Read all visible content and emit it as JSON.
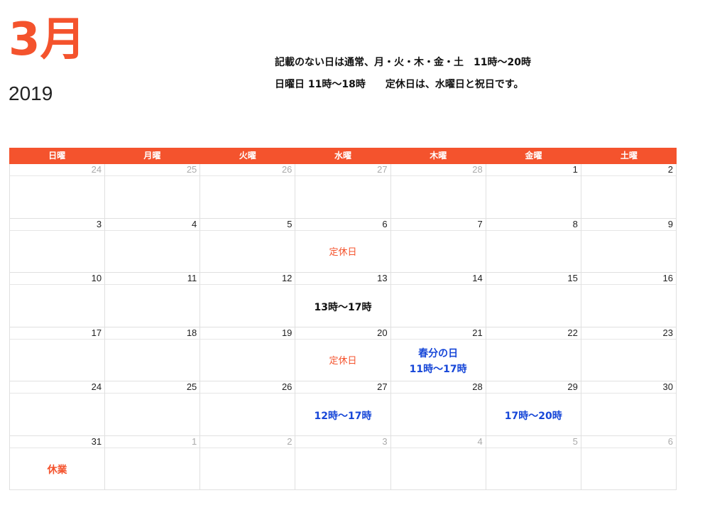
{
  "header": {
    "month": "3月",
    "year": "2019"
  },
  "notes": [
    "記載のない日は通常、月・火・木・金・土　11時〜20時",
    "日曜日 11時〜18時　　定休日は、水曜日と祝日です。"
  ],
  "weekdays": [
    "日曜",
    "月曜",
    "火曜",
    "水曜",
    "木曜",
    "金曜",
    "土曜"
  ],
  "colors": {
    "accent": "#f4532d",
    "blue": "#1747d8"
  },
  "weeks": [
    [
      {
        "day": "24",
        "other": true
      },
      {
        "day": "25",
        "other": true
      },
      {
        "day": "26",
        "other": true
      },
      {
        "day": "27",
        "other": true
      },
      {
        "day": "28",
        "other": true
      },
      {
        "day": "1"
      },
      {
        "day": "2"
      }
    ],
    [
      {
        "day": "3"
      },
      {
        "day": "4"
      },
      {
        "day": "5"
      },
      {
        "day": "6",
        "note": [
          "定休日"
        ],
        "style": "red"
      },
      {
        "day": "7"
      },
      {
        "day": "8"
      },
      {
        "day": "9"
      }
    ],
    [
      {
        "day": "10"
      },
      {
        "day": "11"
      },
      {
        "day": "12"
      },
      {
        "day": "13",
        "note": [
          "13時〜17時"
        ],
        "style": "dark"
      },
      {
        "day": "14"
      },
      {
        "day": "15"
      },
      {
        "day": "16"
      }
    ],
    [
      {
        "day": "17"
      },
      {
        "day": "18"
      },
      {
        "day": "19"
      },
      {
        "day": "20",
        "note": [
          "定休日"
        ],
        "style": "red"
      },
      {
        "day": "21",
        "note": [
          "春分の日",
          "11時〜17時"
        ],
        "style": "blue"
      },
      {
        "day": "22"
      },
      {
        "day": "23"
      }
    ],
    [
      {
        "day": "24"
      },
      {
        "day": "25"
      },
      {
        "day": "26"
      },
      {
        "day": "27",
        "note": [
          "12時〜17時"
        ],
        "style": "blue"
      },
      {
        "day": "28"
      },
      {
        "day": "29",
        "note": [
          "17時〜20時"
        ],
        "style": "blue"
      },
      {
        "day": "30"
      }
    ],
    [
      {
        "day": "31",
        "note": [
          "休業"
        ],
        "style": "redbold"
      },
      {
        "day": "1",
        "other": true
      },
      {
        "day": "2",
        "other": true
      },
      {
        "day": "3",
        "other": true
      },
      {
        "day": "4",
        "other": true
      },
      {
        "day": "5",
        "other": true
      },
      {
        "day": "6",
        "other": true
      }
    ]
  ]
}
